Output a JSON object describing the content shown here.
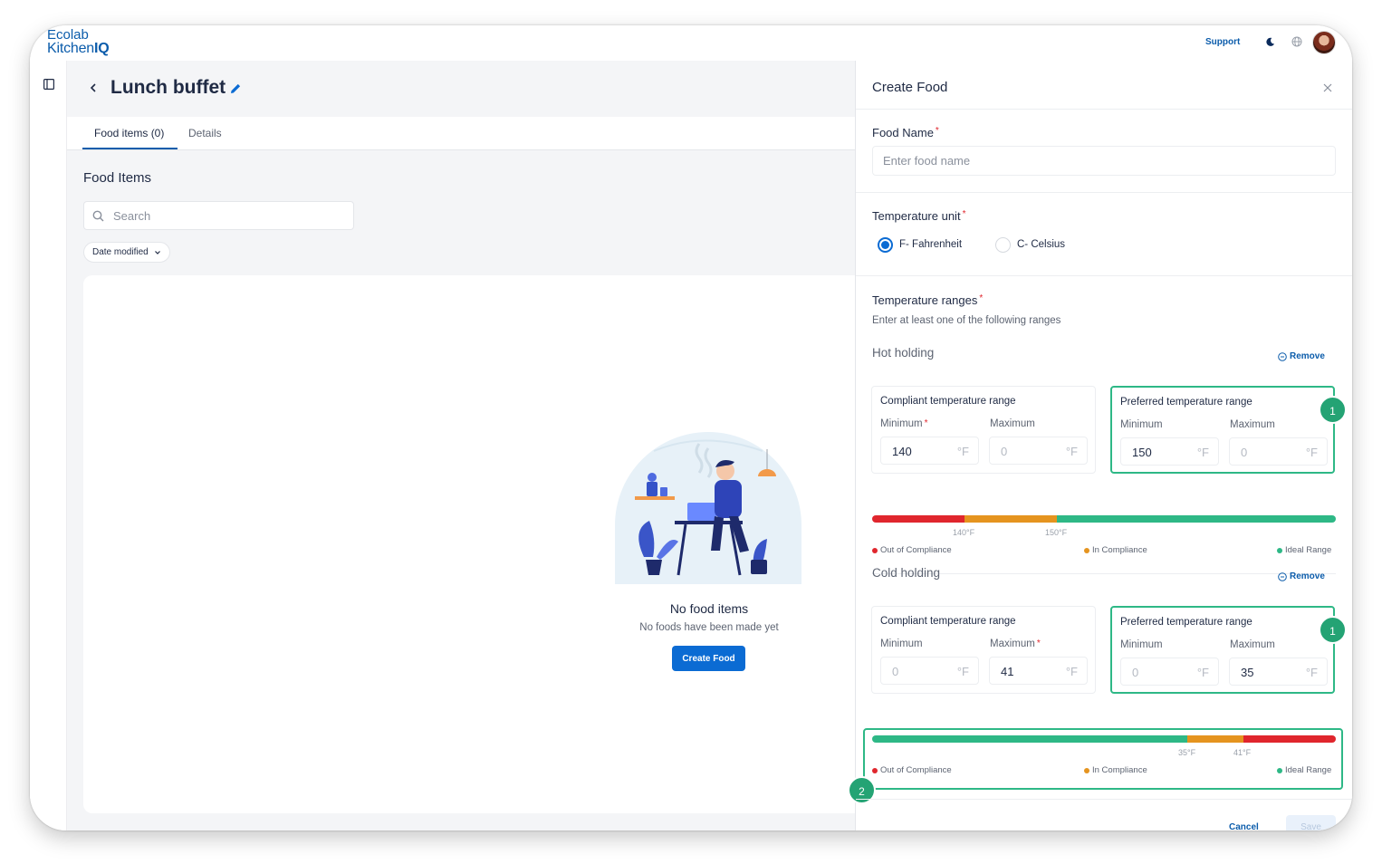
{
  "brand": {
    "line1": "Ecolab",
    "line2_a": "Kitchen",
    "line2_b": "IQ"
  },
  "topbar": {
    "support_label": "Support",
    "theme_icon": "moon-icon",
    "language_icon": "globe-icon"
  },
  "page": {
    "title": "Lunch buffet",
    "tabs": [
      {
        "label": "Food items (0)",
        "active": true
      },
      {
        "label": "Details",
        "active": false
      }
    ],
    "section_title": "Food Items",
    "search": {
      "placeholder": "Search",
      "value": ""
    },
    "sort_label": "Date modified",
    "empty_state": {
      "title": "No food items",
      "subtitle": "No foods have been made yet",
      "button_label": "Create Food"
    }
  },
  "drawer": {
    "title": "Create Food",
    "food_name": {
      "label": "Food Name",
      "placeholder": "Enter food name",
      "value": ""
    },
    "temperature_unit": {
      "label": "Temperature unit",
      "options": [
        {
          "label": "F- Fahrenheit",
          "checked": true
        },
        {
          "label": "C- Celsius",
          "checked": false
        }
      ]
    },
    "temperature_ranges": {
      "label": "Temperature ranges",
      "hint": "Enter at least one of the following ranges",
      "remove_label": "Remove",
      "unit": "°F",
      "compliant_title": "Compliant temperature range",
      "preferred_title": "Preferred temperature range",
      "min_label": "Minimum",
      "max_label": "Maximum",
      "legend": {
        "out": "Out of Compliance",
        "in": "In Compliance",
        "ideal": "Ideal Range"
      },
      "hot": {
        "title": "Hot holding",
        "compliant_min": "140",
        "compliant_max": "0",
        "preferred_min": "150",
        "preferred_max": "0",
        "tick_labels": [
          "140°F",
          "150°F"
        ],
        "badge": "1"
      },
      "cold": {
        "title": "Cold holding",
        "compliant_min": "0",
        "compliant_max": "41",
        "preferred_min": "0",
        "preferred_max": "35",
        "tick_labels": [
          "35°F",
          "41°F"
        ],
        "badge": "1",
        "bar_badge": "2"
      }
    },
    "actions": {
      "cancel_label": "Cancel",
      "save_label": "Save"
    }
  },
  "colors": {
    "accent": "#0b6bd3",
    "brand": "#0b5cab",
    "out": "#e0262d",
    "in": "#e5941f",
    "ideal": "#2eb886"
  }
}
